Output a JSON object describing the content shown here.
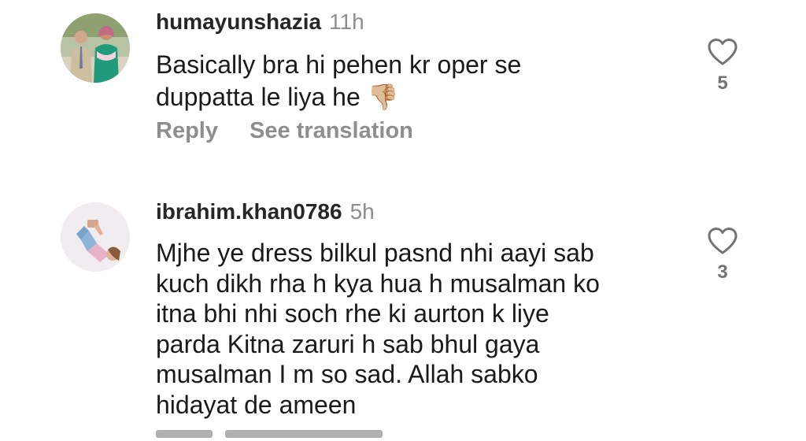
{
  "comments": [
    {
      "username": "humayunshazia",
      "time": "11h",
      "lines": [
        "Basically bra hi pehen kr oper se",
        "duppatta le liya he 👎🏼"
      ],
      "like_count": "5",
      "reply_label": "Reply",
      "translate_label": "See translation"
    },
    {
      "username": "ibrahim.khan0786",
      "time": "5h",
      "lines": [
        "Mjhe ye dress bilkul pasnd nhi aayi sab",
        "kuch dikh rha h kya hua h musalman ko",
        "itna bhi nhi soch rhe ki aurton k liye",
        "parda Kitna zaruri h sab bhul gaya",
        "musalman I m so sad. Allah sabko",
        "hidayat de ameen"
      ],
      "like_count": "3"
    }
  ],
  "icons": {
    "like": "heart-outline-icon"
  },
  "colors": {
    "username": "#262626",
    "meta": "#8e8e8e",
    "text": "#1a1a1a"
  }
}
